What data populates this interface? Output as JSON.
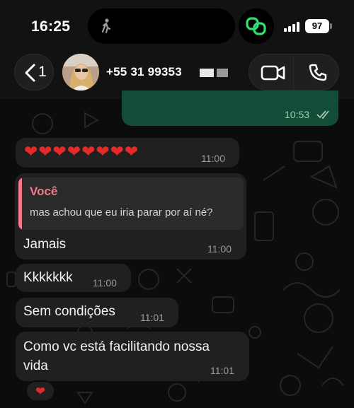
{
  "status_bar": {
    "time": "16:25",
    "battery": "97"
  },
  "header": {
    "back_count": "1",
    "contact_name": "+55 31 99353"
  },
  "messages": [
    {
      "id": "out-partial",
      "direction": "outgoing",
      "text": "",
      "time": "10:53",
      "status": "read"
    },
    {
      "id": "m1",
      "direction": "incoming",
      "text": "❤❤❤❤❤❤❤❤",
      "time": "11:00"
    },
    {
      "id": "m2",
      "direction": "incoming",
      "quote_author": "Você",
      "quote_text": "mas achou que eu iria parar por aí né?",
      "text": "Jamais",
      "time": "11:00"
    },
    {
      "id": "m3",
      "direction": "incoming",
      "text": "Kkkkkkk",
      "time": "11:00"
    },
    {
      "id": "m4",
      "direction": "incoming",
      "text": "Sem condições",
      "time": "11:01"
    },
    {
      "id": "m5",
      "direction": "incoming",
      "text_line1": "Como vc está facilitando nossa",
      "text_line2": "vida",
      "time": "11:01",
      "reaction": "❤"
    }
  ],
  "colors": {
    "outgoing_bubble": "#144d37",
    "incoming_bubble": "#202020",
    "quote_accent": "#f07a8a",
    "heart": "#e52a2a"
  },
  "icons": {
    "back": "chevron-left-icon",
    "video": "video-camera-icon",
    "phone": "phone-icon",
    "read_receipt": "double-check-icon",
    "island": "walking-person-icon",
    "link": "link-icon"
  }
}
